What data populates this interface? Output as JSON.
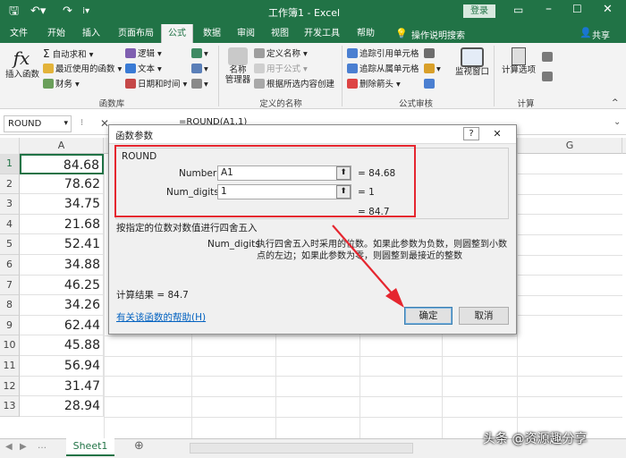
{
  "window": {
    "title": "工作簿1 - Excel",
    "login": "登录"
  },
  "tabs": [
    "文件",
    "开始",
    "插入",
    "页面布局",
    "公式",
    "数据",
    "审阅",
    "视图",
    "开发工具",
    "帮助"
  ],
  "tell_me": "操作说明搜索",
  "share": "共享",
  "ribbon": {
    "insert_function": "插入函数",
    "autosum": "自动求和",
    "recent": "最近使用的函数",
    "finance": "财务",
    "logic": "逻辑",
    "text": "文本",
    "datetime": "日期和时间",
    "lib_group": "函数库",
    "name_manager": "名称\n管理器",
    "define_name": "定义名称",
    "use_in_formula": "用于公式",
    "create_from_sel": "根据所选内容创建",
    "names_group": "定义的名称",
    "trace_prec": "追踪引用单元格",
    "trace_dep": "追踪从属单元格",
    "remove_arrows": "删除箭头",
    "watch": "监视窗口",
    "audit_group": "公式审核",
    "calc_options": "计算选项",
    "calc_group": "计算"
  },
  "formula_bar": {
    "name_box": "ROUND",
    "formula": "=ROUND(A1,1)"
  },
  "columns": [
    "A",
    "G"
  ],
  "rows": [
    "1",
    "2",
    "3",
    "4",
    "5",
    "6",
    "7",
    "8",
    "9",
    "10",
    "11",
    "12",
    "13"
  ],
  "cells": [
    "84.68",
    "78.62",
    "34.75",
    "21.68",
    "52.41",
    "34.88",
    "46.25",
    "34.26",
    "62.44",
    "45.88",
    "56.94",
    "31.47",
    "28.94"
  ],
  "sheet_tab": "Sheet1",
  "dialog": {
    "title": "函数参数",
    "help_glyph": "?",
    "close_glyph": "✕",
    "func": "ROUND",
    "arg1_name": "Number",
    "arg1_value": "A1",
    "arg1_result": "= 84.68",
    "arg2_name": "Num_digits",
    "arg2_value": "1",
    "arg2_result": "= 1",
    "total": "= 84.7",
    "desc": "按指定的位数对数值进行四舍五入",
    "param_name": "Num_digits",
    "param_desc": "执行四舍五入时采用的位数。如果此参数为负数，则圆整到小数点的左边；如果此参数为零，则圆整到最接近的整数",
    "calc_result": "计算结果 =  84.7",
    "help_link": "有关该函数的帮助(H)",
    "ok": "确定",
    "cancel": "取消"
  },
  "watermark": "头条 @资源趣分享",
  "colors": {
    "excel_green": "#217346",
    "highlight_red": "#e5262f",
    "link_blue": "#0563c1"
  }
}
